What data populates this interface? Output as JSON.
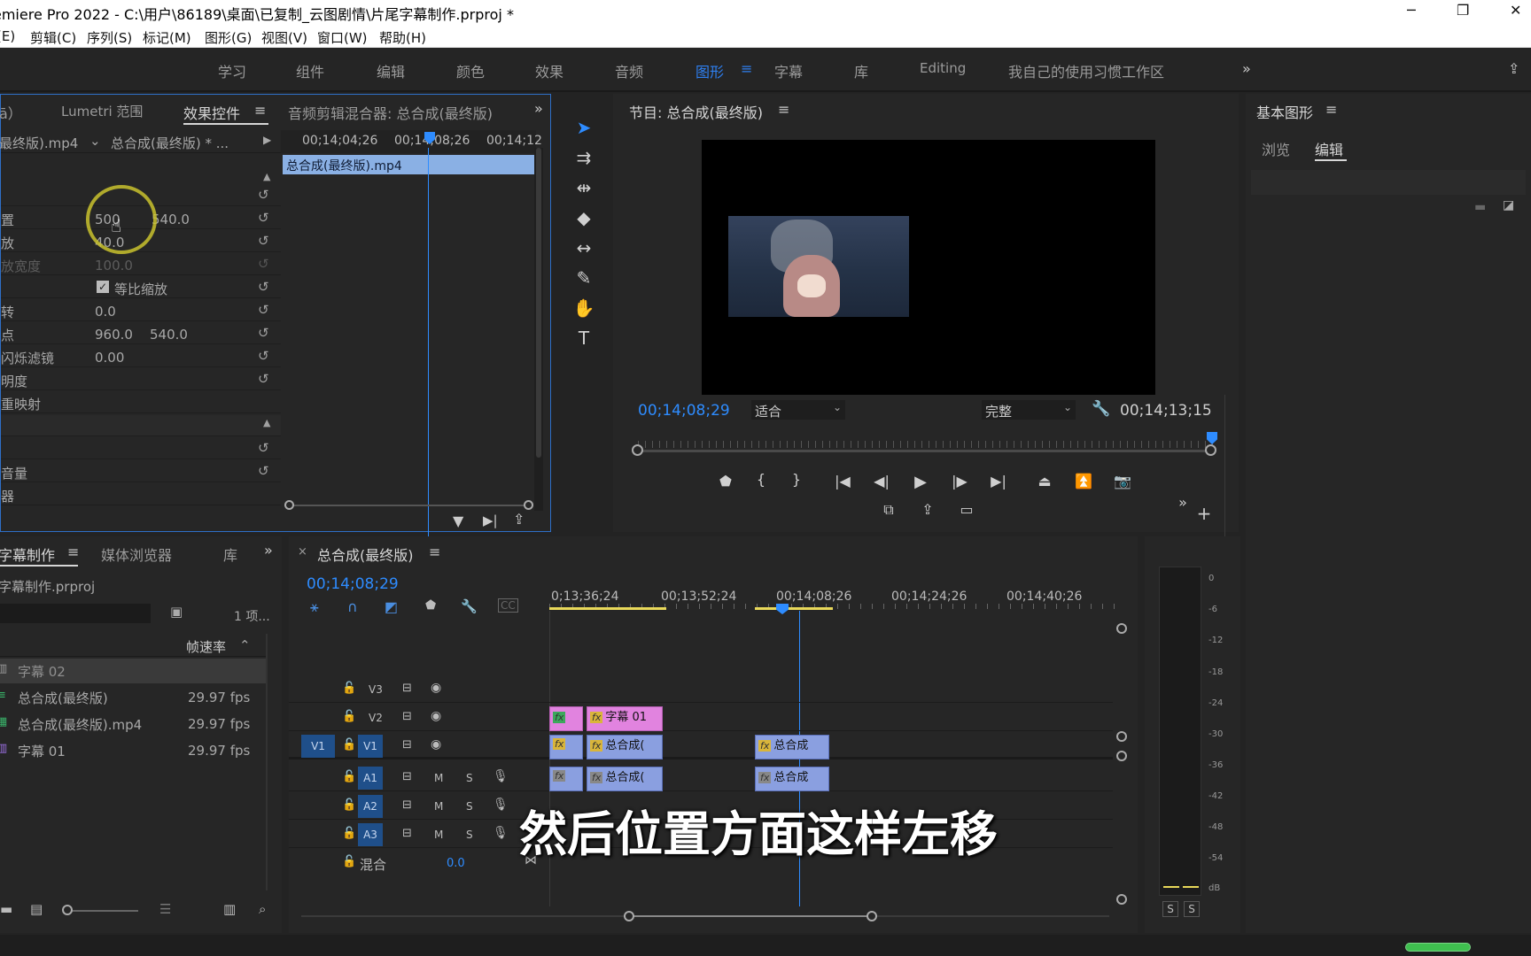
{
  "app": {
    "title": "emiere Pro 2022 - C:\\用户\\86189\\桌面\\已复制_云图剧情\\片尾字幕制作.prproj *"
  },
  "menu": [
    "(E)",
    "剪辑(C)",
    "序列(S)",
    "标记(M)",
    "图形(G)",
    "视图(V)",
    "窗口(W)",
    "帮助(H)"
  ],
  "workspaces": [
    "学习",
    "组件",
    "编辑",
    "颜色",
    "效果",
    "音频",
    "图形",
    "字幕",
    "库",
    "Editing",
    "我自己的使用习惯工作区"
  ],
  "active_workspace": "图形",
  "effect_panel": {
    "tabs": [
      "ā）",
      "Lumetri 范围",
      "效果控件",
      "音频剪辑混合器: 总合成(最终版)"
    ],
    "source_clip": "最终版).mp4",
    "sequence": "总合成(最终版) * ...",
    "timecodes": [
      "00;14;04;26",
      "00;14;08;26",
      "00;14;12"
    ],
    "clip_bar": "总合成(最终版).mp4",
    "props": [
      {
        "name": "置",
        "v1": "500",
        "v2": "540.0"
      },
      {
        "name": "放",
        "v1": "40.0",
        "v2": ""
      },
      {
        "name": "放宽度",
        "v1": "100.0",
        "v2": ""
      },
      {
        "name": "",
        "v1": "等比缩放",
        "v2": ""
      },
      {
        "name": "转",
        "v1": "0.0",
        "v2": ""
      },
      {
        "name": "点",
        "v1": "960.0",
        "v2": "540.0"
      },
      {
        "name": "闪烁滤镜",
        "v1": "0.00",
        "v2": ""
      },
      {
        "name": "明度",
        "v1": "",
        "v2": ""
      },
      {
        "name": "重映射",
        "v1": "",
        "v2": ""
      },
      {
        "name": "",
        "v1": "",
        "v2": ""
      },
      {
        "name": "",
        "v1": "",
        "v2": ""
      },
      {
        "name": "音量",
        "v1": "",
        "v2": ""
      },
      {
        "name": "器",
        "v1": "",
        "v2": ""
      }
    ]
  },
  "program": {
    "title": "节目: 总合成(最终版)",
    "timecode": "00;14;08;29",
    "fit": "适合",
    "quality": "完整",
    "duration": "00;14;13;15"
  },
  "graphics": {
    "title": "基本图形",
    "tabs": [
      "浏览",
      "编辑"
    ]
  },
  "project": {
    "tabs": [
      "字幕制作",
      "媒体浏览器",
      "库"
    ],
    "file": "字幕制作.prproj",
    "count": "1 项...",
    "col": "帧速率",
    "items": [
      {
        "name": "字幕 02",
        "fps": ""
      },
      {
        "name": "总合成(最终版)",
        "fps": "29.97 fps"
      },
      {
        "name": "总合成(最终版).mp4",
        "fps": "29.97 fps"
      },
      {
        "name": "字幕 01",
        "fps": "29.97 fps"
      }
    ]
  },
  "timeline": {
    "tab": "总合成(最终版)",
    "timecode": "00;14;08;29",
    "ruler": [
      "0;13;36;24",
      "00;13;52;24",
      "00;14;08;26",
      "00;14;24;26",
      "00;14;40;26"
    ],
    "tracks": {
      "v3": "V3",
      "v2": "V2",
      "v1": "V1",
      "a1": "A1",
      "a2": "A2",
      "a3": "A3",
      "v1src": "V1",
      "mix": "混合",
      "mixval": "0.0"
    },
    "clips": {
      "title01": "字幕 01",
      "comp": "总合成(",
      "comp2": "总合成",
      "fx": "fx"
    }
  },
  "meter": {
    "scale": [
      "0",
      "-6",
      "-12",
      "-18",
      "-24",
      "-30",
      "-36",
      "-42",
      "-48",
      "-54",
      "dB"
    ],
    "solo": [
      "S",
      "S"
    ]
  },
  "subtitle": "然后位置方面这样左移"
}
